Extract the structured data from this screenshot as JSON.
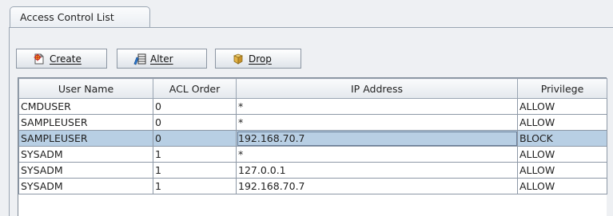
{
  "tab": {
    "label": "Access Control List"
  },
  "toolbar": {
    "create_label": "Create",
    "alter_label": "Alter",
    "drop_label": "Drop"
  },
  "table": {
    "columns": [
      "User Name",
      "ACL Order",
      "IP Address",
      "Privilege"
    ],
    "rows": [
      [
        "CMDUSER",
        "0",
        "*",
        "ALLOW"
      ],
      [
        "SAMPLEUSER",
        "0",
        "*",
        "ALLOW"
      ],
      [
        "SAMPLEUSER",
        "0",
        "192.168.70.7",
        "BLOCK"
      ],
      [
        "SYSADM",
        "1",
        "*",
        "ALLOW"
      ],
      [
        "SYSADM",
        "1",
        "127.0.0.1",
        "ALLOW"
      ],
      [
        "SYSADM",
        "1",
        "192.168.70.7",
        "ALLOW"
      ]
    ],
    "selected_row": 2
  },
  "colors": {
    "selection": "#b8cfe4",
    "background": "#eef0f3"
  }
}
